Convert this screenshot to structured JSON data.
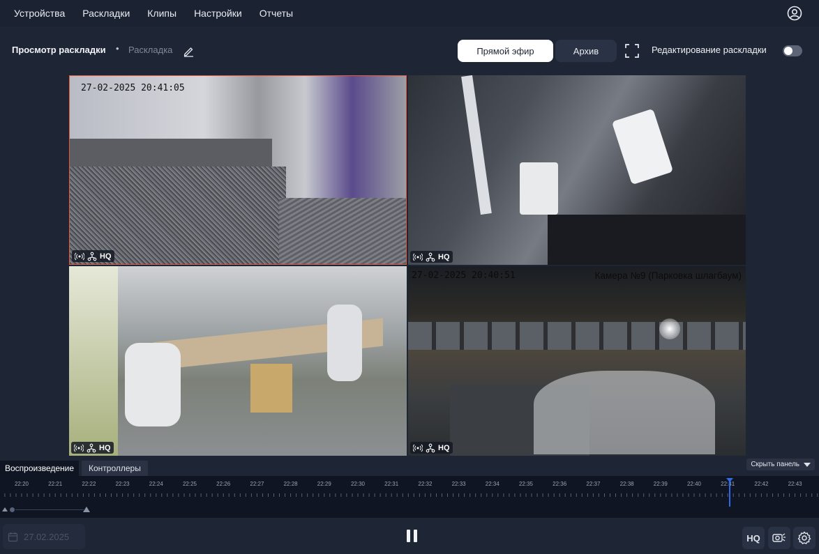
{
  "nav": {
    "items": [
      "Устройства",
      "Раскладки",
      "Клипы",
      "Настройки",
      "Отчеты"
    ]
  },
  "toolbar": {
    "title": "Просмотр раскладки",
    "separator": "•",
    "layout_name": "Раскладка",
    "live_label": "Прямой эфир",
    "archive_label": "Архив",
    "edit_layout_label": "Редактирование раскладки",
    "edit_layout_enabled": false
  },
  "cameras": [
    {
      "timestamp": "27-02-2025 20:41:05",
      "name": "",
      "quality": "HQ",
      "selected": true
    },
    {
      "timestamp": "",
      "name": "",
      "quality": "HQ",
      "selected": false
    },
    {
      "timestamp": "",
      "name": "",
      "quality": "HQ",
      "selected": false
    },
    {
      "timestamp": "27-02-2025 20:40:51",
      "name": "Камера №9 (Парковка шлагбаум)",
      "quality": "HQ",
      "selected": false
    }
  ],
  "panel": {
    "tab_playback": "Воспроизведение",
    "tab_controllers": "Контроллеры",
    "hide_panel": "Скрыть панель"
  },
  "timeline": {
    "labels": [
      "22:20",
      "22:21",
      "22:22",
      "22:23",
      "22:24",
      "22:25",
      "22:26",
      "22:27",
      "22:28",
      "22:29",
      "22:30",
      "22:31",
      "22:32",
      "22:33",
      "22:34",
      "22:35",
      "22:36",
      "22:37",
      "22:38",
      "22:39",
      "22:40",
      "22:41",
      "22:42",
      "22:43"
    ],
    "cursor_time": "22:41"
  },
  "bottom": {
    "date_placeholder": "27.02.2025",
    "hq_label": "HQ"
  },
  "colors": {
    "background": "#1e2636",
    "accent": "#2f6be8",
    "selected_border": "#e3583c"
  }
}
